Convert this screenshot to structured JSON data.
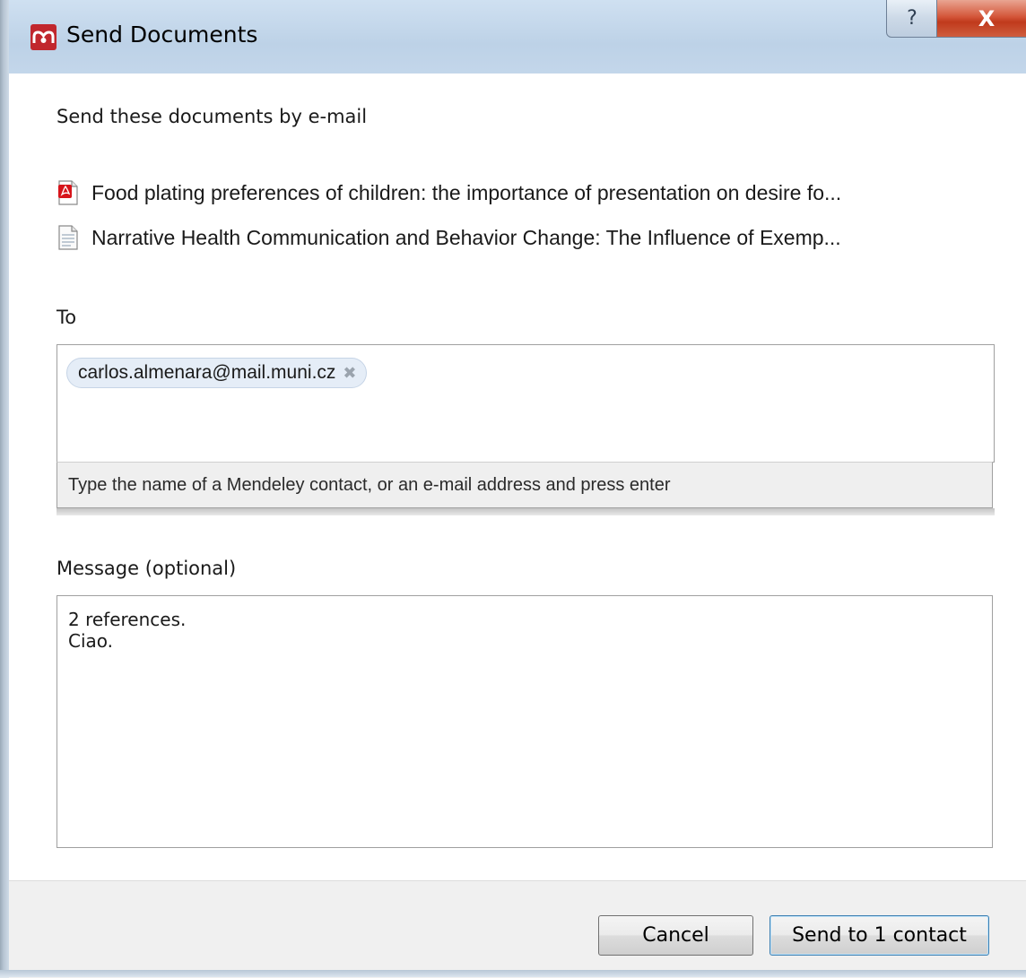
{
  "window": {
    "title": "Send Documents",
    "app_icon": "mendeley-logo-icon",
    "help_label": "?",
    "close_label": "X"
  },
  "intro": "Send these documents by e-mail",
  "documents": [
    {
      "icon": "pdf-document-icon",
      "title": "Food plating preferences of children: the importance of presentation on desire fo..."
    },
    {
      "icon": "text-document-icon",
      "title": "Narrative Health Communication and Behavior Change: The Influence of Exemp..."
    }
  ],
  "to": {
    "label": "To",
    "recipients": [
      {
        "address": "carlos.almenara@mail.muni.cz",
        "remove_label": "✖"
      }
    ],
    "hint": "Type the name of a Mendeley contact, or an e-mail address and press enter"
  },
  "message": {
    "label": "Message (optional)",
    "lines": [
      "2 references.",
      "Ciao."
    ]
  },
  "buttons": {
    "cancel": "Cancel",
    "send": "Send to 1 contact"
  },
  "colors": {
    "brand": "#c1272d",
    "close_button": "#c84a2c",
    "chip_bg": "#e5edf7"
  }
}
